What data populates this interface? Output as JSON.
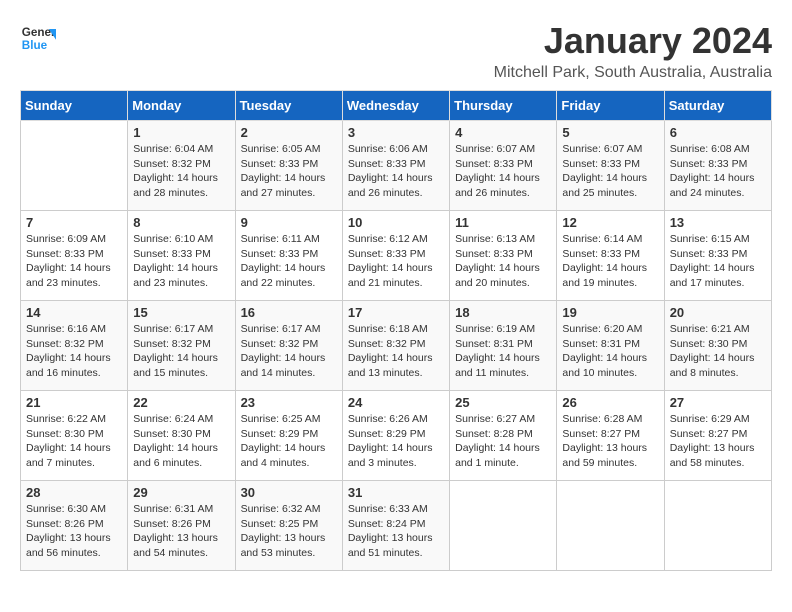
{
  "logo": {
    "general": "General",
    "blue": "Blue"
  },
  "title": "January 2024",
  "subtitle": "Mitchell Park, South Australia, Australia",
  "days_of_week": [
    "Sunday",
    "Monday",
    "Tuesday",
    "Wednesday",
    "Thursday",
    "Friday",
    "Saturday"
  ],
  "weeks": [
    [
      {
        "day": "",
        "info": ""
      },
      {
        "day": "1",
        "info": "Sunrise: 6:04 AM\nSunset: 8:32 PM\nDaylight: 14 hours\nand 28 minutes."
      },
      {
        "day": "2",
        "info": "Sunrise: 6:05 AM\nSunset: 8:33 PM\nDaylight: 14 hours\nand 27 minutes."
      },
      {
        "day": "3",
        "info": "Sunrise: 6:06 AM\nSunset: 8:33 PM\nDaylight: 14 hours\nand 26 minutes."
      },
      {
        "day": "4",
        "info": "Sunrise: 6:07 AM\nSunset: 8:33 PM\nDaylight: 14 hours\nand 26 minutes."
      },
      {
        "day": "5",
        "info": "Sunrise: 6:07 AM\nSunset: 8:33 PM\nDaylight: 14 hours\nand 25 minutes."
      },
      {
        "day": "6",
        "info": "Sunrise: 6:08 AM\nSunset: 8:33 PM\nDaylight: 14 hours\nand 24 minutes."
      }
    ],
    [
      {
        "day": "7",
        "info": "Sunrise: 6:09 AM\nSunset: 8:33 PM\nDaylight: 14 hours\nand 23 minutes."
      },
      {
        "day": "8",
        "info": "Sunrise: 6:10 AM\nSunset: 8:33 PM\nDaylight: 14 hours\nand 23 minutes."
      },
      {
        "day": "9",
        "info": "Sunrise: 6:11 AM\nSunset: 8:33 PM\nDaylight: 14 hours\nand 22 minutes."
      },
      {
        "day": "10",
        "info": "Sunrise: 6:12 AM\nSunset: 8:33 PM\nDaylight: 14 hours\nand 21 minutes."
      },
      {
        "day": "11",
        "info": "Sunrise: 6:13 AM\nSunset: 8:33 PM\nDaylight: 14 hours\nand 20 minutes."
      },
      {
        "day": "12",
        "info": "Sunrise: 6:14 AM\nSunset: 8:33 PM\nDaylight: 14 hours\nand 19 minutes."
      },
      {
        "day": "13",
        "info": "Sunrise: 6:15 AM\nSunset: 8:33 PM\nDaylight: 14 hours\nand 17 minutes."
      }
    ],
    [
      {
        "day": "14",
        "info": "Sunrise: 6:16 AM\nSunset: 8:32 PM\nDaylight: 14 hours\nand 16 minutes."
      },
      {
        "day": "15",
        "info": "Sunrise: 6:17 AM\nSunset: 8:32 PM\nDaylight: 14 hours\nand 15 minutes."
      },
      {
        "day": "16",
        "info": "Sunrise: 6:17 AM\nSunset: 8:32 PM\nDaylight: 14 hours\nand 14 minutes."
      },
      {
        "day": "17",
        "info": "Sunrise: 6:18 AM\nSunset: 8:32 PM\nDaylight: 14 hours\nand 13 minutes."
      },
      {
        "day": "18",
        "info": "Sunrise: 6:19 AM\nSunset: 8:31 PM\nDaylight: 14 hours\nand 11 minutes."
      },
      {
        "day": "19",
        "info": "Sunrise: 6:20 AM\nSunset: 8:31 PM\nDaylight: 14 hours\nand 10 minutes."
      },
      {
        "day": "20",
        "info": "Sunrise: 6:21 AM\nSunset: 8:30 PM\nDaylight: 14 hours\nand 8 minutes."
      }
    ],
    [
      {
        "day": "21",
        "info": "Sunrise: 6:22 AM\nSunset: 8:30 PM\nDaylight: 14 hours\nand 7 minutes."
      },
      {
        "day": "22",
        "info": "Sunrise: 6:24 AM\nSunset: 8:30 PM\nDaylight: 14 hours\nand 6 minutes."
      },
      {
        "day": "23",
        "info": "Sunrise: 6:25 AM\nSunset: 8:29 PM\nDaylight: 14 hours\nand 4 minutes."
      },
      {
        "day": "24",
        "info": "Sunrise: 6:26 AM\nSunset: 8:29 PM\nDaylight: 14 hours\nand 3 minutes."
      },
      {
        "day": "25",
        "info": "Sunrise: 6:27 AM\nSunset: 8:28 PM\nDaylight: 14 hours\nand 1 minute."
      },
      {
        "day": "26",
        "info": "Sunrise: 6:28 AM\nSunset: 8:27 PM\nDaylight: 13 hours\nand 59 minutes."
      },
      {
        "day": "27",
        "info": "Sunrise: 6:29 AM\nSunset: 8:27 PM\nDaylight: 13 hours\nand 58 minutes."
      }
    ],
    [
      {
        "day": "28",
        "info": "Sunrise: 6:30 AM\nSunset: 8:26 PM\nDaylight: 13 hours\nand 56 minutes."
      },
      {
        "day": "29",
        "info": "Sunrise: 6:31 AM\nSunset: 8:26 PM\nDaylight: 13 hours\nand 54 minutes."
      },
      {
        "day": "30",
        "info": "Sunrise: 6:32 AM\nSunset: 8:25 PM\nDaylight: 13 hours\nand 53 minutes."
      },
      {
        "day": "31",
        "info": "Sunrise: 6:33 AM\nSunset: 8:24 PM\nDaylight: 13 hours\nand 51 minutes."
      },
      {
        "day": "",
        "info": ""
      },
      {
        "day": "",
        "info": ""
      },
      {
        "day": "",
        "info": ""
      }
    ]
  ]
}
